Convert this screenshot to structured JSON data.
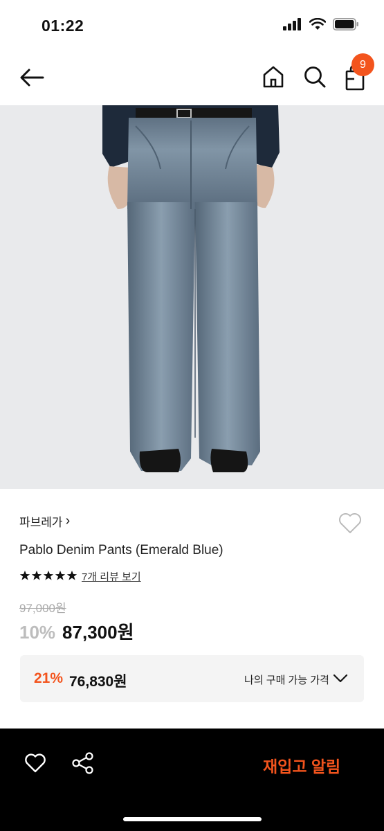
{
  "status_bar": {
    "time": "01:22"
  },
  "nav": {
    "back_icon": "arrow-left-icon",
    "home_icon": "home-icon",
    "search_icon": "search-icon",
    "bag_icon": "shopping-bag-icon",
    "cart_count": "9"
  },
  "product": {
    "brand": "파브레가",
    "brand_chevron": "›",
    "name": "Pablo Denim Pants (Emerald Blue)",
    "rating_stars": 5,
    "review_link": "7개 리뷰 보기",
    "original_price": "97,000원",
    "discount": "10%",
    "price": "87,300원"
  },
  "my_price": {
    "discount": "21%",
    "price": "76,830원",
    "label": "나의 구매 가능 가격"
  },
  "bottom_bar": {
    "wish_icon": "heart-icon",
    "share_icon": "share-icon",
    "restock_label": "재입고 알림"
  },
  "colors": {
    "accent": "#f3541d",
    "bottom_bg": "#000000",
    "hero_bg": "#e9eaec"
  }
}
